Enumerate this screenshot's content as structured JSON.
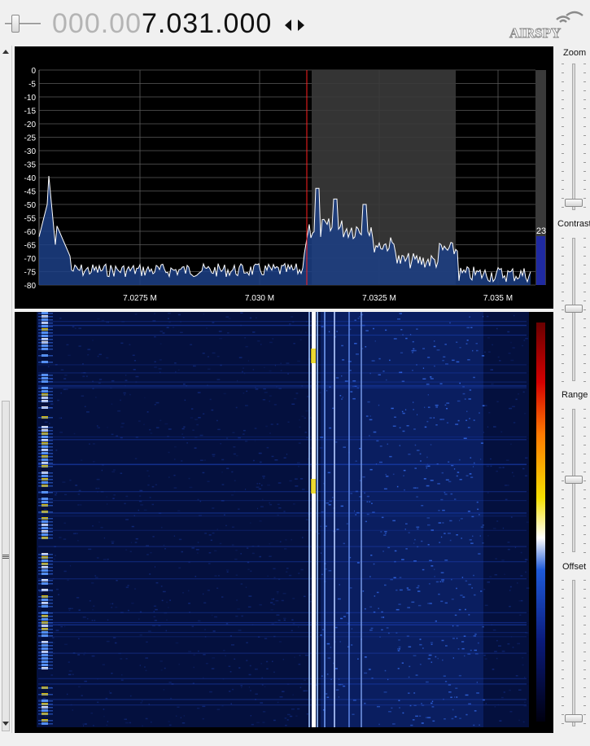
{
  "frequency": {
    "dim_part": "000.00",
    "lit_part": "7.031.000"
  },
  "logo": {
    "text": "AIRSPY"
  },
  "spectrum": {
    "db_ticks": [
      "0",
      "-5",
      "-10",
      "-15",
      "-20",
      "-25",
      "-30",
      "-35",
      "-40",
      "-45",
      "-50",
      "-55",
      "-60",
      "-65",
      "-70",
      "-75",
      "-80"
    ],
    "freq_ticks": [
      "7.0275 M",
      "7.030 M",
      "7.0325 M",
      "7.035 M"
    ],
    "level_value": "23",
    "colors": {
      "background": "#000000",
      "trace": "#ffffff",
      "fill": "#1c3f86",
      "marker": "#ff2020",
      "band": "#3a3a3a"
    }
  },
  "controls": {
    "zoom_label": "Zoom",
    "contrast_label": "Contrast",
    "range_label": "Range",
    "offset_label": "Offset"
  },
  "icons": {
    "step": "left-right-arrows-icon",
    "logo": "airspy-logo",
    "grip": "grip-icon"
  }
}
